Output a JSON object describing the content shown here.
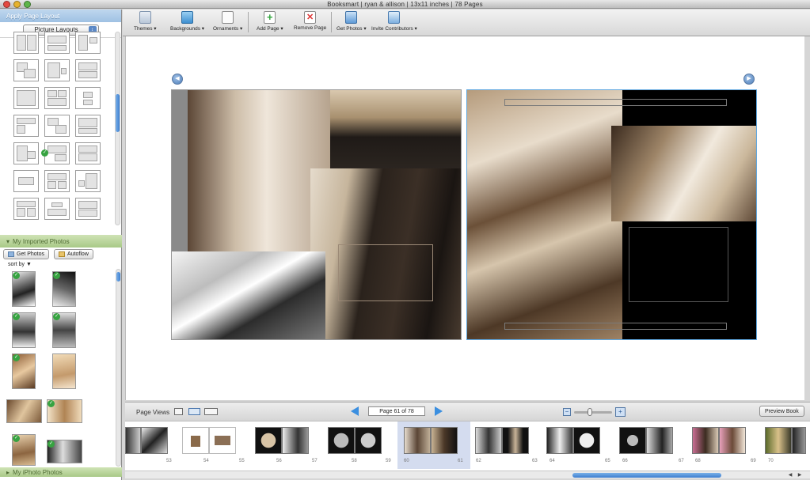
{
  "window": {
    "title": "Booksmart | ryan & allison | 13x11 inches | 78 Pages"
  },
  "sidebar": {
    "layout_panel_title": "Apply Page Layout",
    "layout_select_value": "Picture Layouts",
    "photos_panel_title": "My Imported Photos",
    "get_photos_label": "Get Photos",
    "autoflow_label": "Autoflow",
    "sort_by_label": "sort by ▼",
    "iphoto_panel_title": "My iPhoto Photos"
  },
  "toolbar": {
    "items": [
      {
        "label": "Themes ▾",
        "icon": "themes-icon"
      },
      {
        "label": "Backgrounds ▾",
        "icon": "backgrounds-icon"
      },
      {
        "label": "Ornaments ▾",
        "icon": "ornaments-icon"
      },
      {
        "label": "Add Page ▾",
        "icon": "add-page-icon"
      },
      {
        "label": "Remove Page",
        "icon": "remove-page-icon"
      },
      {
        "label": "Get Photos ▾",
        "icon": "get-photos-icon"
      },
      {
        "label": "Invite Contributors ▾",
        "icon": "invite-contributors-icon"
      }
    ]
  },
  "page_views": {
    "label": "Page Views",
    "page_field": "Page 61 of 78",
    "preview_label": "Preview Book",
    "zoom_level": 0.4
  },
  "strip": {
    "page_numbers": [
      "53",
      "54",
      "55",
      "56",
      "57",
      "58",
      "59",
      "60",
      "61",
      "62",
      "63",
      "64",
      "65",
      "66",
      "67",
      "68",
      "69",
      "70"
    ],
    "selected_spread": "60-61"
  },
  "colors": {
    "accent": "#3e7fd0",
    "check": "#37a341",
    "sepia_dark": "#4a3525",
    "sepia_light": "#d9c9b4"
  }
}
